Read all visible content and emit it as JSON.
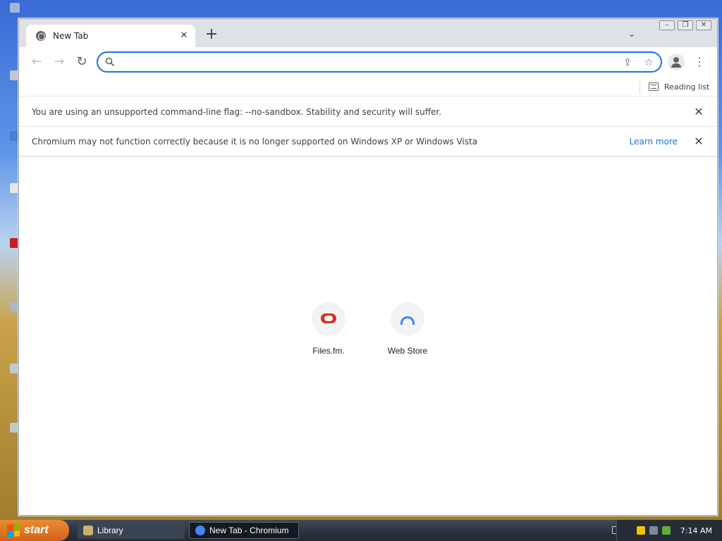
{
  "browser": {
    "tab": {
      "title": "New Tab"
    },
    "toolbar": {
      "url_value": "",
      "url_placeholder": ""
    },
    "bookmarks": {
      "reading_list_label": "Reading list"
    },
    "infobars": [
      {
        "message": "You are using an unsupported command-line flag: --no-sandbox. Stability and security will suffer.",
        "link": ""
      },
      {
        "message": "Chromium may not function correctly because it is no longer supported on Windows XP or Windows Vista",
        "link": "Learn more"
      }
    ],
    "shortcuts": [
      {
        "label": "Files.fm."
      },
      {
        "label": "Web Store"
      }
    ],
    "colors": {
      "accent": "#1a73e8",
      "tab_strip": "#dee1e6",
      "files_icon": "#d93025",
      "store_icon": "#4285f4"
    }
  },
  "taskbar": {
    "start_label": "start",
    "tasks": [
      {
        "label": "Library",
        "icon": "folder-icon"
      },
      {
        "label": "New Tab - Chromium",
        "icon": "chromium-icon"
      }
    ],
    "clock": "7:14 AM"
  }
}
